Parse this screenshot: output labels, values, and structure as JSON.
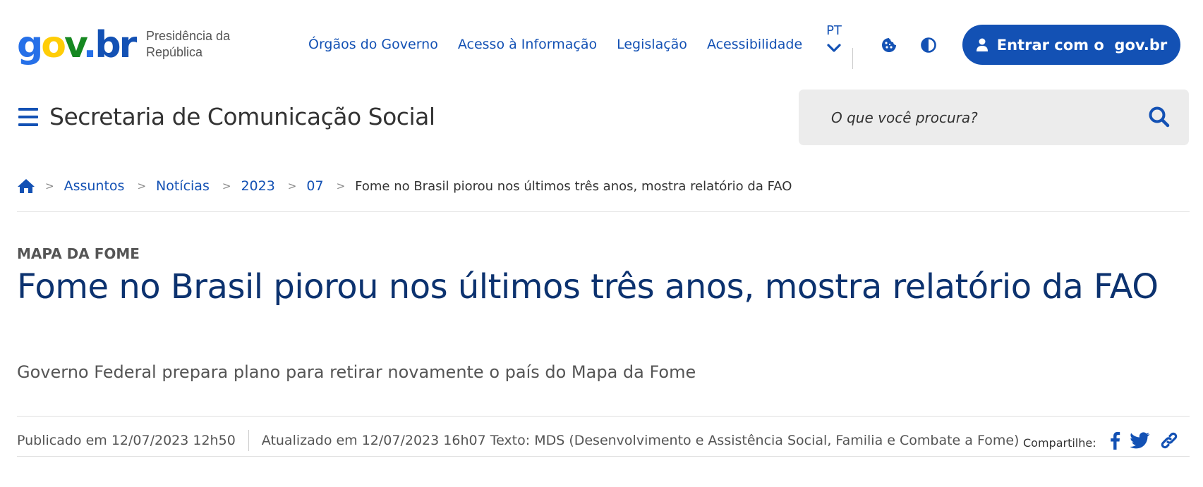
{
  "header": {
    "logo_parts": {
      "g": "g",
      "o": "o",
      "v": "v",
      "dot": ".",
      "br": "br"
    },
    "org_name": "Presidência da República",
    "nav": [
      {
        "label": "Órgãos do Governo"
      },
      {
        "label": "Acesso à Informação"
      },
      {
        "label": "Legislação"
      },
      {
        "label": "Acessibilidade"
      }
    ],
    "language": "PT",
    "login_label": "Entrar com o  gov.br",
    "site_title": "Secretaria de Comunicação Social",
    "search_placeholder": "O que você procura?"
  },
  "breadcrumb": {
    "items": [
      "Assuntos",
      "Notícias",
      "2023",
      "07"
    ],
    "current": "Fome no Brasil piorou nos últimos três anos, mostra relatório da FAO",
    "separator": ">"
  },
  "article": {
    "kicker": "MAPA DA FOME",
    "title": "Fome no Brasil piorou nos últimos três anos, mostra relatório da FAO",
    "subtitle": "Governo Federal prepara plano para retirar novamente o país do Mapa da Fome",
    "published": "Publicado em 12/07/2023 12h50",
    "updated": "Atualizado em 12/07/2023 16h07 Texto: MDS (Desenvolvimento e Assistência Social, Familia e Combate a Fome)",
    "share_label": "Compartilhe:"
  },
  "colors": {
    "primary_blue": "#1351b4",
    "headline_blue": "#0c326f",
    "search_bg": "#ececec"
  },
  "icons": {
    "cookie": "cookie-icon",
    "contrast": "contrast-icon",
    "user": "user-icon",
    "menu": "hamburger-menu-icon",
    "search": "search-icon",
    "home": "home-icon",
    "facebook": "facebook-icon",
    "twitter": "twitter-icon",
    "link": "link-icon"
  }
}
